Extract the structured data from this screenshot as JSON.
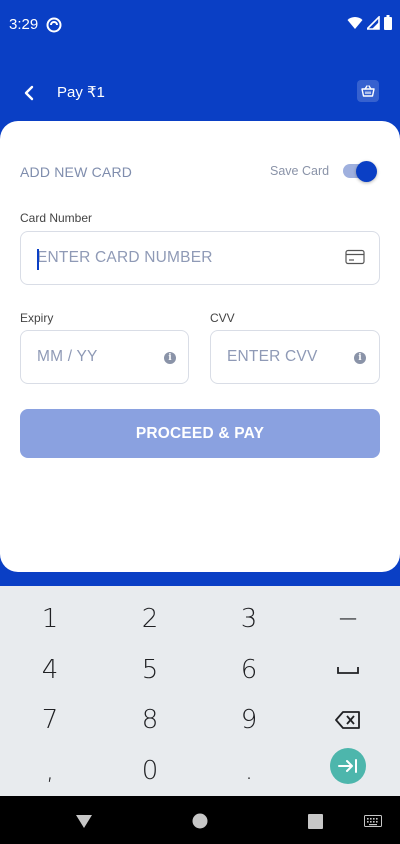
{
  "status_bar": {
    "time": "3:29"
  },
  "header": {
    "title": "Pay ₹1"
  },
  "card_form": {
    "section_title": "ADD NEW CARD",
    "save_card_label": "Save Card",
    "save_card_enabled": true,
    "card_number": {
      "label": "Card Number",
      "placeholder": "ENTER CARD NUMBER",
      "value": ""
    },
    "expiry": {
      "label": "Expiry",
      "placeholder": "MM / YY",
      "value": ""
    },
    "cvv": {
      "label": "CVV",
      "placeholder": "ENTER CVV",
      "value": ""
    },
    "submit_label": "PROCEED & PAY"
  },
  "keyboard": {
    "keys": [
      "1",
      "2",
      "3",
      "−",
      "4",
      "5",
      "6",
      "⎵",
      "7",
      "8",
      "9",
      "⌫",
      ",",
      "0",
      "."
    ]
  },
  "colors": {
    "brand": "#0a3fc5",
    "button_disabled": "#8aa1e0",
    "enter_key": "#4db6ac"
  }
}
